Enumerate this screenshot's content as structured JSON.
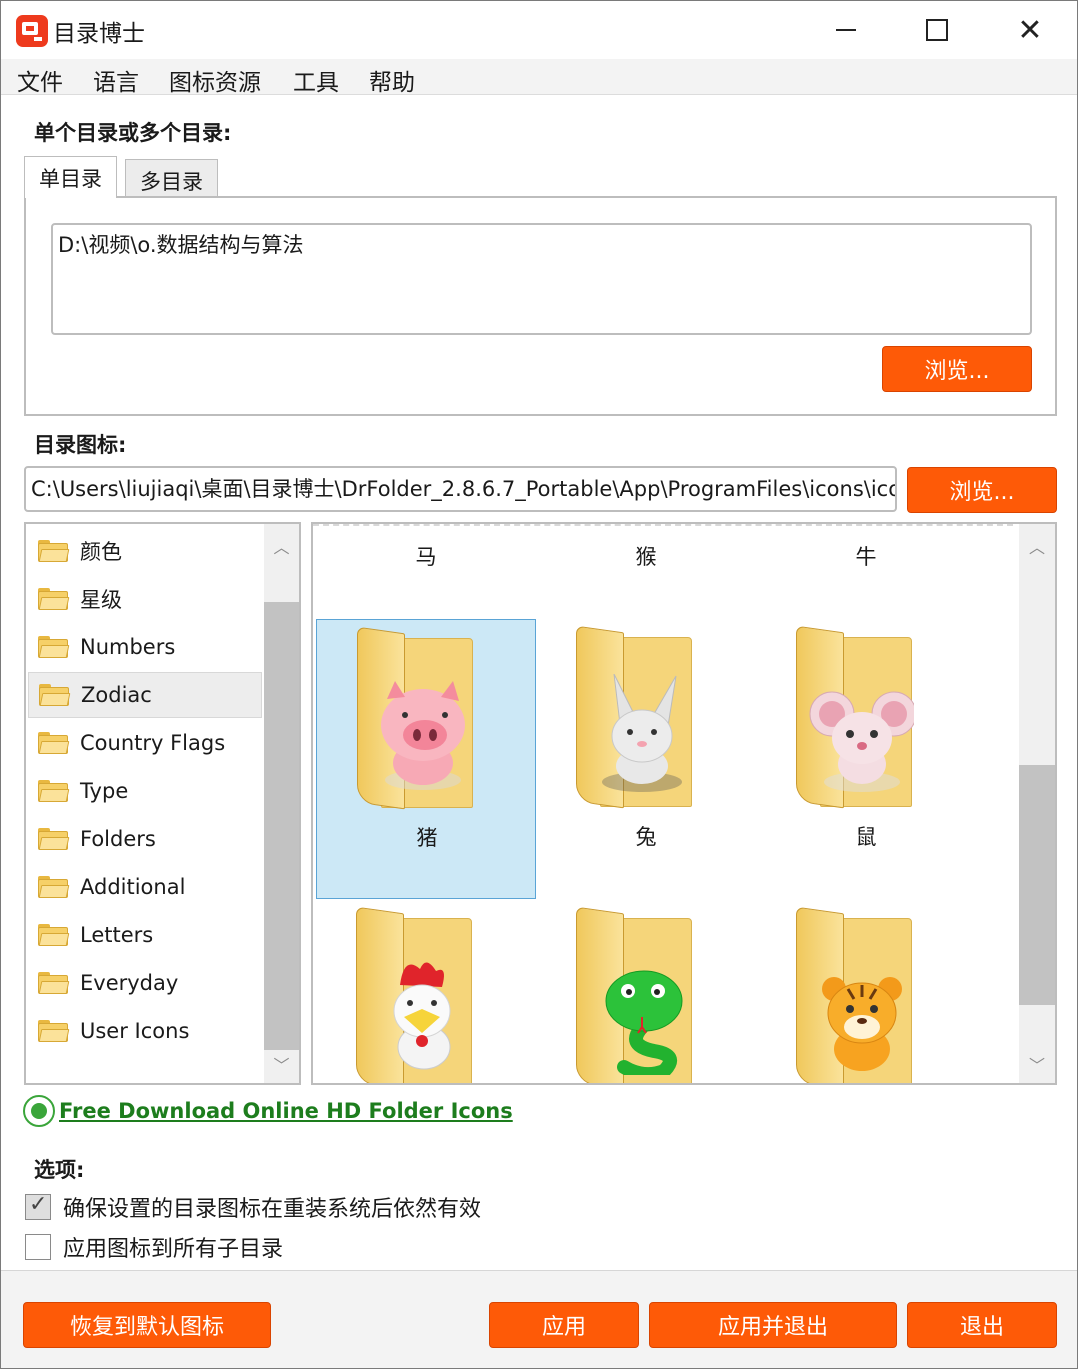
{
  "window": {
    "title": "目录博士"
  },
  "menu": [
    "文件",
    "语言",
    "图标资源",
    "工具",
    "帮助"
  ],
  "directory_section": {
    "label": "单个目录或多个目录:",
    "tabs": [
      "单目录",
      "多目录"
    ],
    "path_value": "D:\\视频\\o.数据结构与算法",
    "browse_label": "浏览..."
  },
  "icon_section": {
    "label": "目录图标:",
    "path_value": "C:\\Users\\liujiaqi\\桌面\\目录博士\\DrFolder_2.8.6.7_Portable\\App\\ProgramFiles\\icons\\ico",
    "browse_label": "浏览..."
  },
  "categories": [
    "颜色",
    "星级",
    "Numbers",
    "Zodiac",
    "Country Flags",
    "Type",
    "Folders",
    "Additional",
    "Letters",
    "Everyday",
    "User Icons"
  ],
  "selected_category": "Zodiac",
  "icons": {
    "top_row_labels": [
      "马",
      "猴",
      "牛"
    ],
    "row2": [
      "猪",
      "兔",
      "鼠"
    ],
    "selected": "猪"
  },
  "link": {
    "text": "Free Download Online HD Folder Icons",
    "color": "#1d7d1d"
  },
  "options": {
    "label": "选项:",
    "items": [
      {
        "label": "确保设置的目录图标在重装系统后依然有效",
        "checked": true
      },
      {
        "label": "应用图标到所有子目录",
        "checked": false
      }
    ]
  },
  "footer": {
    "restore": "恢复到默认图标",
    "apply": "应用",
    "apply_exit": "应用并退出",
    "exit": "退出"
  },
  "accent": "#fe5a07"
}
